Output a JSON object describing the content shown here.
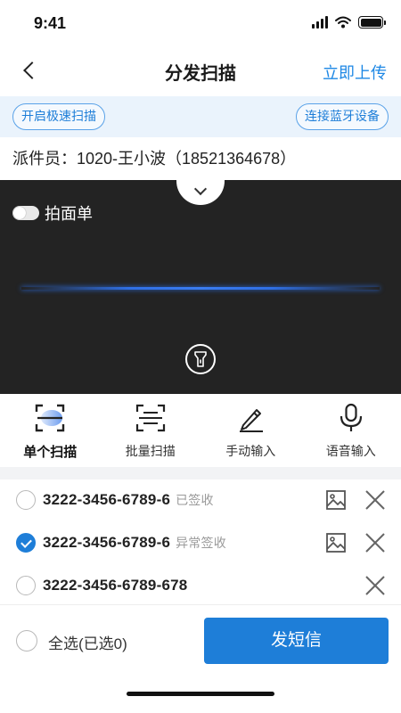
{
  "status_bar": {
    "time": "9:41"
  },
  "nav": {
    "title": "分发扫描",
    "action": "立即上传"
  },
  "quick_bar": {
    "left_pill": "开启极速扫描",
    "right_pill": "连接蓝牙设备"
  },
  "courier": {
    "text": "派件员：1020-王小波（18521364678）"
  },
  "camera": {
    "toggle_label": "拍面单",
    "toggle_on": false
  },
  "modes": [
    {
      "label": "单个扫描",
      "icon": "single-scan-icon",
      "active": true
    },
    {
      "label": "批量扫描",
      "icon": "batch-scan-icon",
      "active": false
    },
    {
      "label": "手动输入",
      "icon": "pen-icon",
      "active": false
    },
    {
      "label": "语音输入",
      "icon": "microphone-icon",
      "active": false
    }
  ],
  "items": [
    {
      "tracking": "3222-3456-6789-6",
      "status": "已签收",
      "checked": false,
      "has_image": true
    },
    {
      "tracking": "3222-3456-6789-6",
      "status": "异常签收",
      "checked": true,
      "has_image": true
    },
    {
      "tracking": "3222-3456-6789-678",
      "status": "",
      "checked": false,
      "has_image": false
    }
  ],
  "bottom_bar": {
    "select_all_label": "全选(已选0)",
    "send_button": "发短信"
  },
  "colors": {
    "accent": "#1e7ed8",
    "camera_bg": "#232323",
    "quick_bar_bg": "#eaf3fc",
    "scan_line": "#2f6fe4"
  }
}
